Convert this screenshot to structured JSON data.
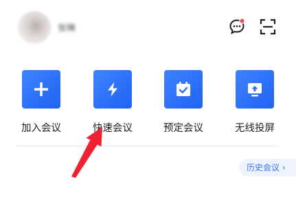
{
  "header": {
    "username": "张琳",
    "message_icon": "chat-bubble-icon",
    "scan_icon": "scan-icon",
    "notification_dot_color": "#f24b3f"
  },
  "features": [
    {
      "label": "加入会议",
      "icon": "plus-icon"
    },
    {
      "label": "快速会议",
      "icon": "lightning-icon"
    },
    {
      "label": "预定会议",
      "icon": "calendar-check-icon"
    },
    {
      "label": "无线投屏",
      "icon": "screen-cast-icon"
    }
  ],
  "history": {
    "label": "历史会议",
    "chevron": "›"
  },
  "colors": {
    "accent": "#2b6ff6",
    "annotation_arrow": "#ee2233"
  }
}
